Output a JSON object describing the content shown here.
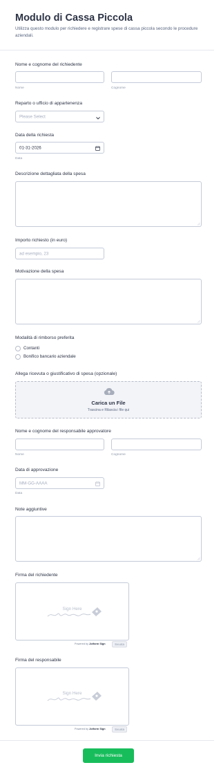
{
  "form": {
    "title": "Modulo di Cassa Piccola",
    "description": "Utilizza questo modulo per richiedere e registrare spese di cassa piccola secondo le procedure aziendali."
  },
  "requester": {
    "label": "Nome e cognome del richiedente",
    "first_sub": "Nome",
    "last_sub": "Cognome"
  },
  "department": {
    "label": "Reparto o ufficio di appartenenza",
    "placeholder": "Please Select"
  },
  "request_date": {
    "label": "Data della richiesta",
    "value": "01-31-2026",
    "sub": "Data"
  },
  "expense_desc": {
    "label": "Descrizione dettagliata della spesa"
  },
  "amount": {
    "label": "Importo richiesto (in euro)",
    "placeholder": "ad esempio, 23"
  },
  "reason": {
    "label": "Motivazione della spesa"
  },
  "reimbursement": {
    "label": "Modalità di rimborso preferita",
    "options": [
      "Contanti",
      "Bonifico bancario aziendale"
    ]
  },
  "attachment": {
    "label": "Allega ricevuta o giustificativo di spesa (opzionale)",
    "button": "Carica un File",
    "hint": "Trascina e Rilascia i file qui"
  },
  "approver": {
    "label": "Nome e cognome del responsabile approvatore",
    "first_sub": "Nome",
    "last_sub": "Cognome"
  },
  "approval_date": {
    "label": "Data di approvazione",
    "placeholder": "MM-GG-AAAA",
    "sub": "Data"
  },
  "notes": {
    "label": "Note aggiuntive"
  },
  "sig_requester": {
    "label": "Firma del richiedente",
    "sign_here": "Sign Here",
    "powered_prefix": "Powered by",
    "powered_brand": "Jotform Sign",
    "clear": "Svuota"
  },
  "sig_manager": {
    "label": "Firma del responsabile",
    "sign_here": "Sign Here",
    "powered_prefix": "Powered by",
    "powered_brand": "Jotform Sign",
    "clear": "Svuota"
  },
  "submit": {
    "label": "Invia richiesta"
  },
  "colors": {
    "accent_green": "#18bd5b",
    "text_dark": "#2c3345",
    "border": "#c3cad8"
  }
}
